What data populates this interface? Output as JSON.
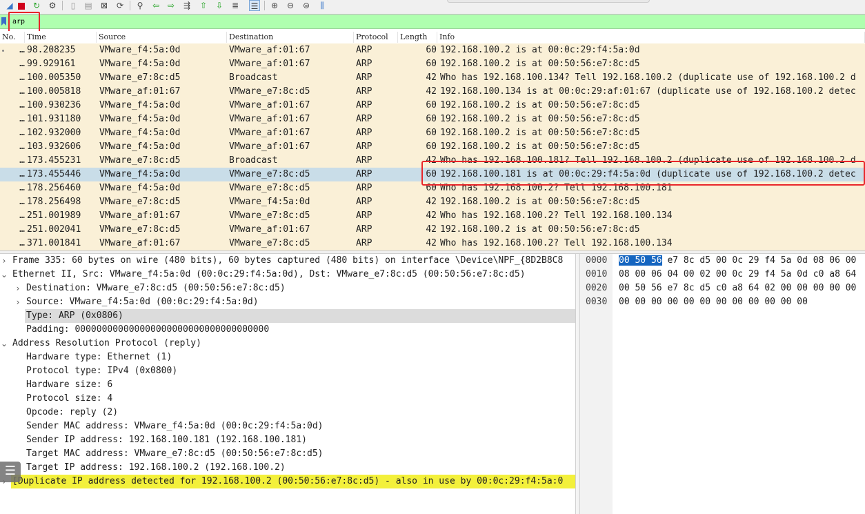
{
  "filter": {
    "value": "arp",
    "placeholder": ""
  },
  "columns": [
    "No.",
    "Time",
    "Source",
    "Destination",
    "Protocol",
    "Length",
    "Info"
  ],
  "packets": [
    {
      "no": "…",
      "time": "98.208235",
      "src": "VMware_f4:5a:0d",
      "dst": "VMware_af:01:67",
      "proto": "ARP",
      "len": "60",
      "info": "192.168.100.2 is at 00:0c:29:f4:5a:0d"
    },
    {
      "no": "…",
      "time": "99.929161",
      "src": "VMware_f4:5a:0d",
      "dst": "VMware_af:01:67",
      "proto": "ARP",
      "len": "60",
      "info": "192.168.100.2 is at 00:50:56:e7:8c:d5"
    },
    {
      "no": "…",
      "time": "100.005350",
      "src": "VMware_e7:8c:d5",
      "dst": "Broadcast",
      "proto": "ARP",
      "len": "42",
      "info": "Who has 192.168.100.134? Tell 192.168.100.2 (duplicate use of 192.168.100.2 d"
    },
    {
      "no": "…",
      "time": "100.005818",
      "src": "VMware_af:01:67",
      "dst": "VMware_e7:8c:d5",
      "proto": "ARP",
      "len": "42",
      "info": "192.168.100.134 is at 00:0c:29:af:01:67 (duplicate use of 192.168.100.2 detec"
    },
    {
      "no": "…",
      "time": "100.930236",
      "src": "VMware_f4:5a:0d",
      "dst": "VMware_af:01:67",
      "proto": "ARP",
      "len": "60",
      "info": "192.168.100.2 is at 00:50:56:e7:8c:d5"
    },
    {
      "no": "…",
      "time": "101.931180",
      "src": "VMware_f4:5a:0d",
      "dst": "VMware_af:01:67",
      "proto": "ARP",
      "len": "60",
      "info": "192.168.100.2 is at 00:50:56:e7:8c:d5"
    },
    {
      "no": "…",
      "time": "102.932000",
      "src": "VMware_f4:5a:0d",
      "dst": "VMware_af:01:67",
      "proto": "ARP",
      "len": "60",
      "info": "192.168.100.2 is at 00:50:56:e7:8c:d5"
    },
    {
      "no": "…",
      "time": "103.932606",
      "src": "VMware_f4:5a:0d",
      "dst": "VMware_af:01:67",
      "proto": "ARP",
      "len": "60",
      "info": "192.168.100.2 is at 00:50:56:e7:8c:d5"
    },
    {
      "no": "…",
      "time": "173.455231",
      "src": "VMware_e7:8c:d5",
      "dst": "Broadcast",
      "proto": "ARP",
      "len": "42",
      "info": "Who has 192.168.100.181? Tell 192.168.100.2 (duplicate use of 192.168.100.2 d"
    },
    {
      "no": "…",
      "time": "173.455446",
      "src": "VMware_f4:5a:0d",
      "dst": "VMware_e7:8c:d5",
      "proto": "ARP",
      "len": "60",
      "info": "192.168.100.181 is at 00:0c:29:f4:5a:0d (duplicate use of 192.168.100.2 detec",
      "selected": true
    },
    {
      "no": "…",
      "time": "178.256460",
      "src": "VMware_f4:5a:0d",
      "dst": "VMware_e7:8c:d5",
      "proto": "ARP",
      "len": "60",
      "info": "Who has 192.168.100.2? Tell 192.168.100.181"
    },
    {
      "no": "…",
      "time": "178.256498",
      "src": "VMware_e7:8c:d5",
      "dst": "VMware_f4:5a:0d",
      "proto": "ARP",
      "len": "42",
      "info": "192.168.100.2 is at 00:50:56:e7:8c:d5"
    },
    {
      "no": "…",
      "time": "251.001989",
      "src": "VMware_af:01:67",
      "dst": "VMware_e7:8c:d5",
      "proto": "ARP",
      "len": "42",
      "info": "Who has 192.168.100.2? Tell 192.168.100.134"
    },
    {
      "no": "…",
      "time": "251.002041",
      "src": "VMware_e7:8c:d5",
      "dst": "VMware_af:01:67",
      "proto": "ARP",
      "len": "42",
      "info": "192.168.100.2 is at 00:50:56:e7:8c:d5"
    },
    {
      "no": "…",
      "time": "371.001841",
      "src": "VMware_af:01:67",
      "dst": "VMware_e7:8c:d5",
      "proto": "ARP",
      "len": "42",
      "info": "Who has 192.168.100.2? Tell 192.168.100.134"
    }
  ],
  "details": [
    {
      "text": "Frame 335: 60 bytes on wire (480 bits), 60 bytes captured (480 bits) on interface \\Device\\NPF_{8D2B8C8",
      "indent": 0,
      "arrow": "›",
      "hl": ""
    },
    {
      "text": "Ethernet II, Src: VMware_f4:5a:0d (00:0c:29:f4:5a:0d), Dst: VMware_e7:8c:d5 (00:50:56:e7:8c:d5)",
      "indent": 0,
      "arrow": "⌄",
      "hl": ""
    },
    {
      "text": "Destination: VMware_e7:8c:d5 (00:50:56:e7:8c:d5)",
      "indent": 1,
      "arrow": "›",
      "hl": ""
    },
    {
      "text": "Source: VMware_f4:5a:0d (00:0c:29:f4:5a:0d)",
      "indent": 1,
      "arrow": "›",
      "hl": ""
    },
    {
      "text": "Type: ARP (0x0806)",
      "indent": 1,
      "arrow": "",
      "hl": "gray"
    },
    {
      "text": "Padding: 000000000000000000000000000000000000",
      "indent": 1,
      "arrow": "",
      "hl": ""
    },
    {
      "text": "Address Resolution Protocol (reply)",
      "indent": 0,
      "arrow": "⌄",
      "hl": ""
    },
    {
      "text": "Hardware type: Ethernet (1)",
      "indent": 1,
      "arrow": "",
      "hl": ""
    },
    {
      "text": "Protocol type: IPv4 (0x0800)",
      "indent": 1,
      "arrow": "",
      "hl": ""
    },
    {
      "text": "Hardware size: 6",
      "indent": 1,
      "arrow": "",
      "hl": ""
    },
    {
      "text": "Protocol size: 4",
      "indent": 1,
      "arrow": "",
      "hl": ""
    },
    {
      "text": "Opcode: reply (2)",
      "indent": 1,
      "arrow": "",
      "hl": ""
    },
    {
      "text": "Sender MAC address: VMware_f4:5a:0d (00:0c:29:f4:5a:0d)",
      "indent": 1,
      "arrow": "",
      "hl": ""
    },
    {
      "text": "Sender IP address: 192.168.100.181 (192.168.100.181)",
      "indent": 1,
      "arrow": "",
      "hl": ""
    },
    {
      "text": "Target MAC address: VMware_e7:8c:d5 (00:50:56:e7:8c:d5)",
      "indent": 1,
      "arrow": "",
      "hl": ""
    },
    {
      "text": "Target IP address: 192.168.100.2 (192.168.100.2)",
      "indent": 1,
      "arrow": "",
      "hl": ""
    },
    {
      "text": "[Duplicate IP address detected for 192.168.100.2 (00:50:56:e7:8c:d5) - also in use by 00:0c:29:f4:5a:0",
      "indent": 0,
      "arrow": "›",
      "hl": "yellow"
    }
  ],
  "bytes": [
    {
      "offset": "0000",
      "sel": "00 50 56",
      "rest": " e7 8c d5 00 0c  29 f4 5a 0d 08 06 00"
    },
    {
      "offset": "0010",
      "sel": "",
      "rest": "08 00 06 04 00 02 00 0c  29 f4 5a 0d c0 a8 64"
    },
    {
      "offset": "0020",
      "sel": "",
      "rest": "00 50 56 e7 8c d5 c0 a8  64 02 00 00 00 00 00"
    },
    {
      "offset": "0030",
      "sel": "",
      "rest": "00 00 00 00 00 00 00 00  00 00 00 00"
    }
  ],
  "toolbar_icons": [
    "shark-fin-start-icon",
    "stop-capture-icon",
    "restart-capture-icon",
    "capture-options-icon",
    "open-file-icon",
    "save-file-icon",
    "close-file-icon",
    "reload-icon",
    "find-packet-icon",
    "go-back-icon",
    "go-forward-icon",
    "go-to-packet-icon",
    "first-packet-icon",
    "last-packet-icon",
    "auto-scroll-icon",
    "colorize-icon",
    "zoom-in-icon",
    "zoom-out-icon",
    "normal-size-icon",
    "resize-columns-icon"
  ],
  "colors": {
    "filter_bg": "#afffaf",
    "row_bg": "#faf0d7",
    "row_selected_bg": "#c9dde8",
    "annotation_red": "#e8262a",
    "expert_yellow": "#f3f03b",
    "byte_highlight": "#1565c0"
  }
}
